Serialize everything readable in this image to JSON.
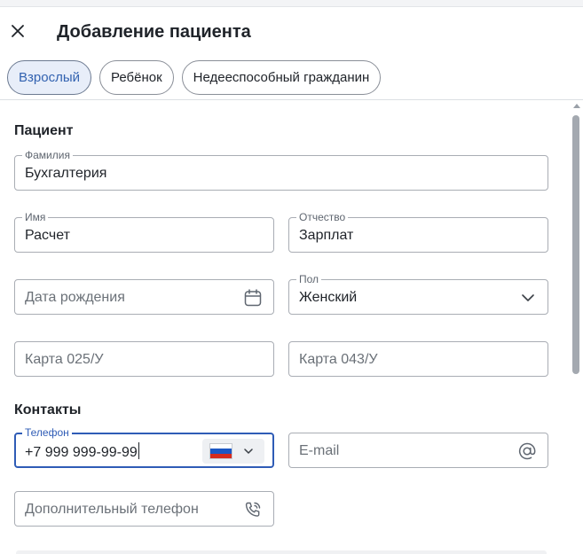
{
  "header": {
    "title": "Добавление пациента"
  },
  "tabs": [
    {
      "label": "Взрослый",
      "active": true
    },
    {
      "label": "Ребёнок",
      "active": false
    },
    {
      "label": "Недееспособный гражданин",
      "active": false
    }
  ],
  "patient": {
    "section_title": "Пациент",
    "last_name": {
      "label": "Фамилия",
      "value": "Бухгалтерия"
    },
    "first_name": {
      "label": "Имя",
      "value": "Расчет"
    },
    "middle_name": {
      "label": "Отчество",
      "value": "Зарплат"
    },
    "birth_date": {
      "placeholder": "Дата рождения"
    },
    "gender": {
      "label": "Пол",
      "value": "Женский"
    },
    "card_025": {
      "placeholder": "Карта 025/У"
    },
    "card_043": {
      "placeholder": "Карта 043/У"
    }
  },
  "contacts": {
    "section_title": "Контакты",
    "phone": {
      "label": "Телефон",
      "value": "+7 999 999-99-99",
      "country": "RU"
    },
    "email": {
      "placeholder": "E-mail"
    },
    "extra_phone": {
      "placeholder": "Дополнительный телефон"
    }
  },
  "colors": {
    "accent": "#2f5cb6",
    "active_tab_bg": "#e8eef9",
    "border": "#a9adb4",
    "flag_white": "#ffffff",
    "flag_blue": "#1c57c4",
    "flag_red": "#d52b1e"
  },
  "icons": [
    "close-icon",
    "calendar-icon",
    "chevron-down-icon",
    "at-sign-icon",
    "phone-call-icon",
    "russia-flag-icon"
  ]
}
